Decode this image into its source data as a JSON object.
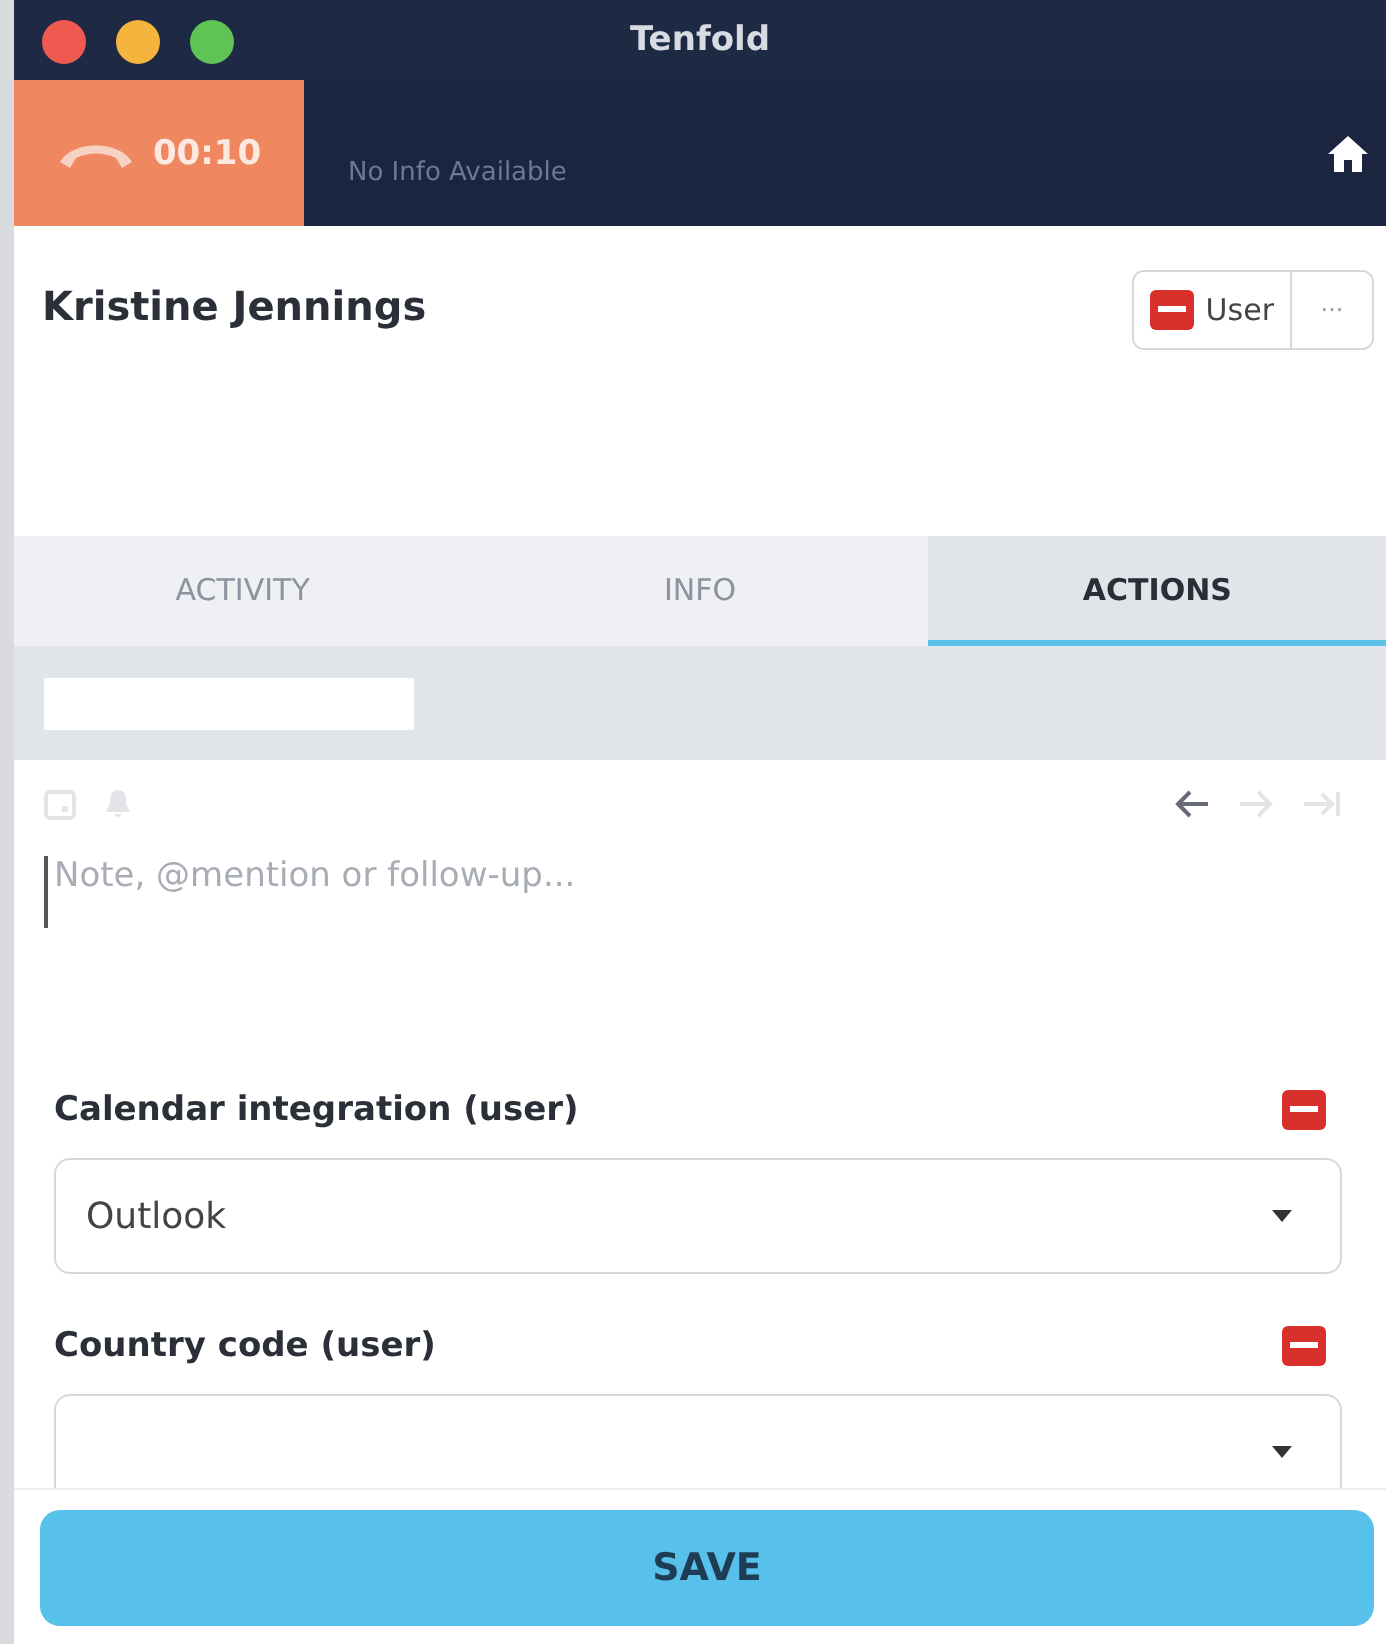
{
  "window": {
    "title": "Tenfold"
  },
  "call": {
    "timer": "00:10",
    "caller_info": "No Info Available"
  },
  "contact": {
    "name": "Kristine Jennings",
    "type_button": "User",
    "more_button": "···"
  },
  "tabs": [
    {
      "label": "ACTIVITY",
      "selected": false
    },
    {
      "label": "INFO",
      "selected": false
    },
    {
      "label": "ACTIONS",
      "selected": true
    }
  ],
  "note": {
    "placeholder": "Note, @mention or follow-up..."
  },
  "fields": [
    {
      "label": "Calendar integration (user)",
      "value": "Outlook"
    },
    {
      "label": "Country code (user)"
    }
  ],
  "save_button": "SAVE"
}
